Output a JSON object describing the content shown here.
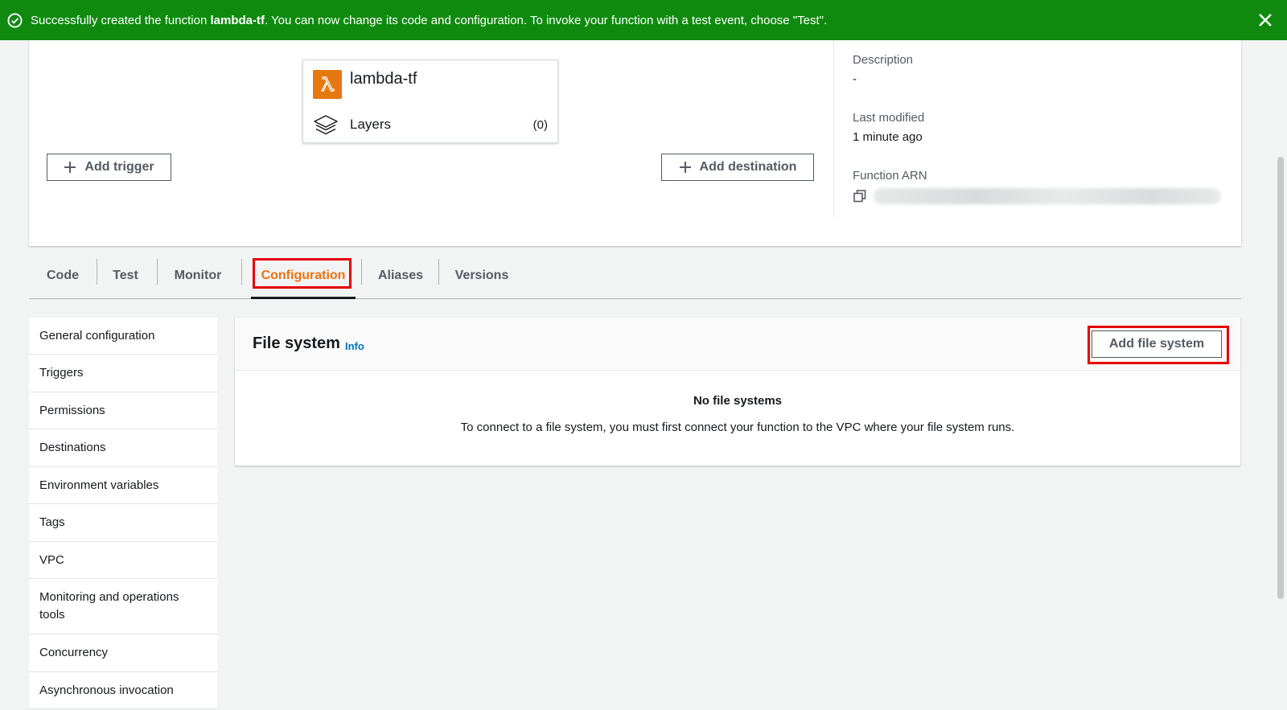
{
  "flash": {
    "prefix": "Successfully created the function ",
    "function_name": "lambda-tf",
    "suffix": ". You can now change its code and configuration. To invoke your function with a test event, choose \"Test\".",
    "color": "#0f8a0f"
  },
  "overview": {
    "function_name": "lambda-tf",
    "layers_label": "Layers",
    "layers_count": "(0)",
    "add_trigger": "Add trigger",
    "add_destination": "Add destination",
    "description_label": "Description",
    "description_value": "-",
    "last_modified_label": "Last modified",
    "last_modified_value": "1 minute ago",
    "arn_label": "Function ARN"
  },
  "tabs": [
    {
      "label": "Code"
    },
    {
      "label": "Test"
    },
    {
      "label": "Monitor"
    },
    {
      "label": "Configuration",
      "active": true
    },
    {
      "label": "Aliases"
    },
    {
      "label": "Versions"
    }
  ],
  "sidebar": {
    "items": [
      {
        "label": "General configuration"
      },
      {
        "label": "Triggers"
      },
      {
        "label": "Permissions"
      },
      {
        "label": "Destinations"
      },
      {
        "label": "Environment variables"
      },
      {
        "label": "Tags"
      },
      {
        "label": "VPC"
      },
      {
        "label": "Monitoring and operations tools"
      },
      {
        "label": "Concurrency"
      },
      {
        "label": "Asynchronous invocation"
      }
    ]
  },
  "file_system": {
    "title": "File system",
    "info": "Info",
    "add_button": "Add file system",
    "empty_title": "No file systems",
    "empty_desc": "To connect to a file system, you must first connect your function to the VPC where your file system runs."
  },
  "colors": {
    "accent": "#ec7211",
    "link": "#0073bb",
    "highlight": "#e60000",
    "lambda": "#e47911"
  }
}
